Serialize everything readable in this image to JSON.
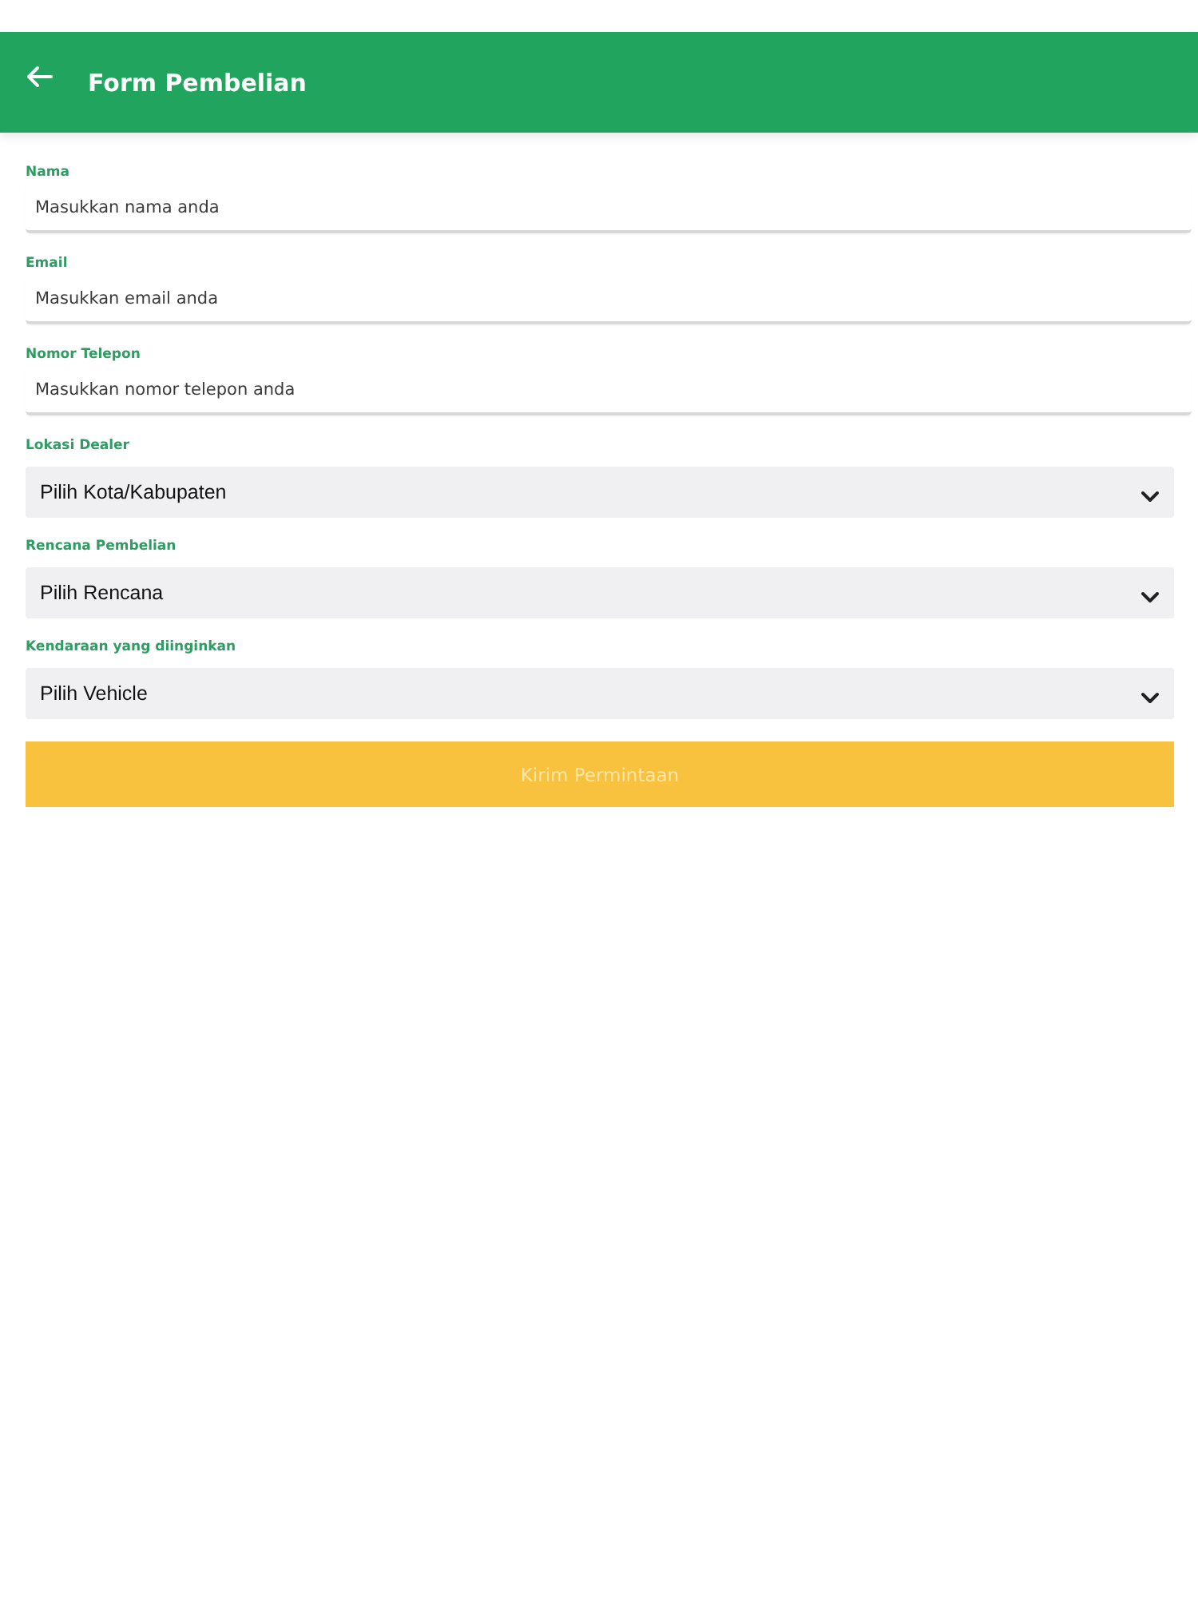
{
  "header": {
    "title": "Form Pembelian"
  },
  "fields": [
    {
      "kind": "text",
      "label": "Nama",
      "placeholder": "Masukkan nama anda"
    },
    {
      "kind": "text",
      "label": "Email",
      "placeholder": "Masukkan email anda"
    },
    {
      "kind": "text",
      "label": "Nomor Telepon",
      "placeholder": "Masukkan nomor telepon anda"
    },
    {
      "kind": "select",
      "label": "Lokasi Dealer",
      "value": "Pilih Kota/Kabupaten"
    },
    {
      "kind": "select",
      "label": "Rencana Pembelian",
      "value": "Pilih Rencana"
    },
    {
      "kind": "select",
      "label": "Kendaraan yang diinginkan",
      "value": "Pilih Vehicle"
    }
  ],
  "submit_button": {
    "label": "Kirim Permintaan",
    "disabled": true
  }
}
